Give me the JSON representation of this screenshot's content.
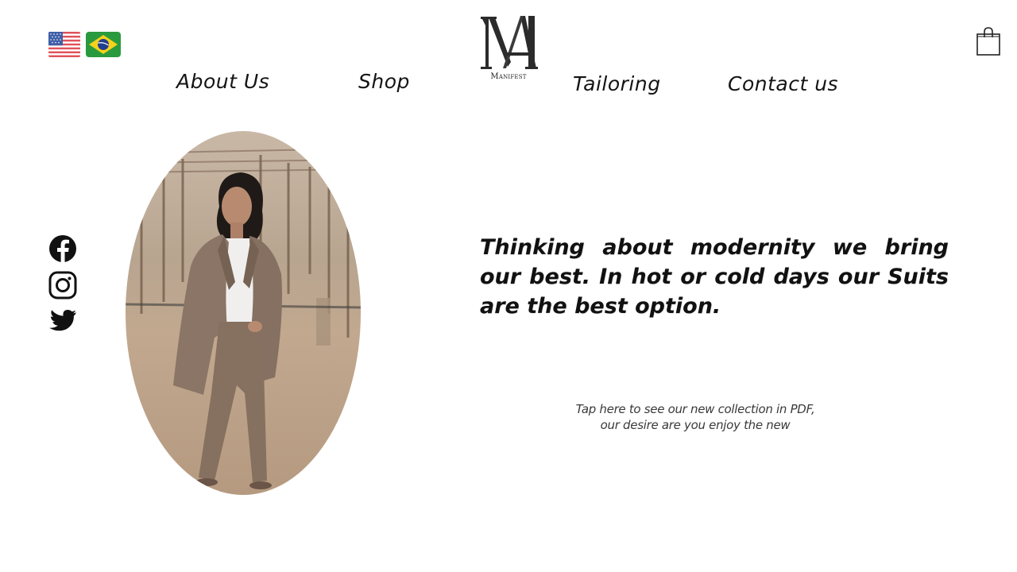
{
  "languages": [
    {
      "name": "English",
      "flag": "us-flag-icon"
    },
    {
      "name": "Português",
      "flag": "brazil-flag-icon"
    }
  ],
  "brand": {
    "logo_mark": "MA",
    "name": "Manifest"
  },
  "nav": {
    "about": "About Us",
    "shop": "Shop",
    "tailoring": "Tailoring",
    "contact": "Contact us"
  },
  "cart": {
    "icon": "shopping-bag-icon"
  },
  "social": [
    {
      "network": "Facebook",
      "icon": "facebook-icon"
    },
    {
      "network": "Instagram",
      "icon": "instagram-icon"
    },
    {
      "network": "Twitter",
      "icon": "twitter-icon"
    }
  ],
  "hero": {
    "image_icon": "model-in-taupe-suit-photo",
    "headline": "Thinking about modernity we bring our best. In hot or cold days our Suits are the best option."
  },
  "collection": {
    "line1": "Tap here to see our new collection in PDF,",
    "line2": "our desire are you enjoy the new"
  },
  "colors": {
    "text": "#111111",
    "suit": "#8a7566",
    "ground": "#b39a82"
  }
}
